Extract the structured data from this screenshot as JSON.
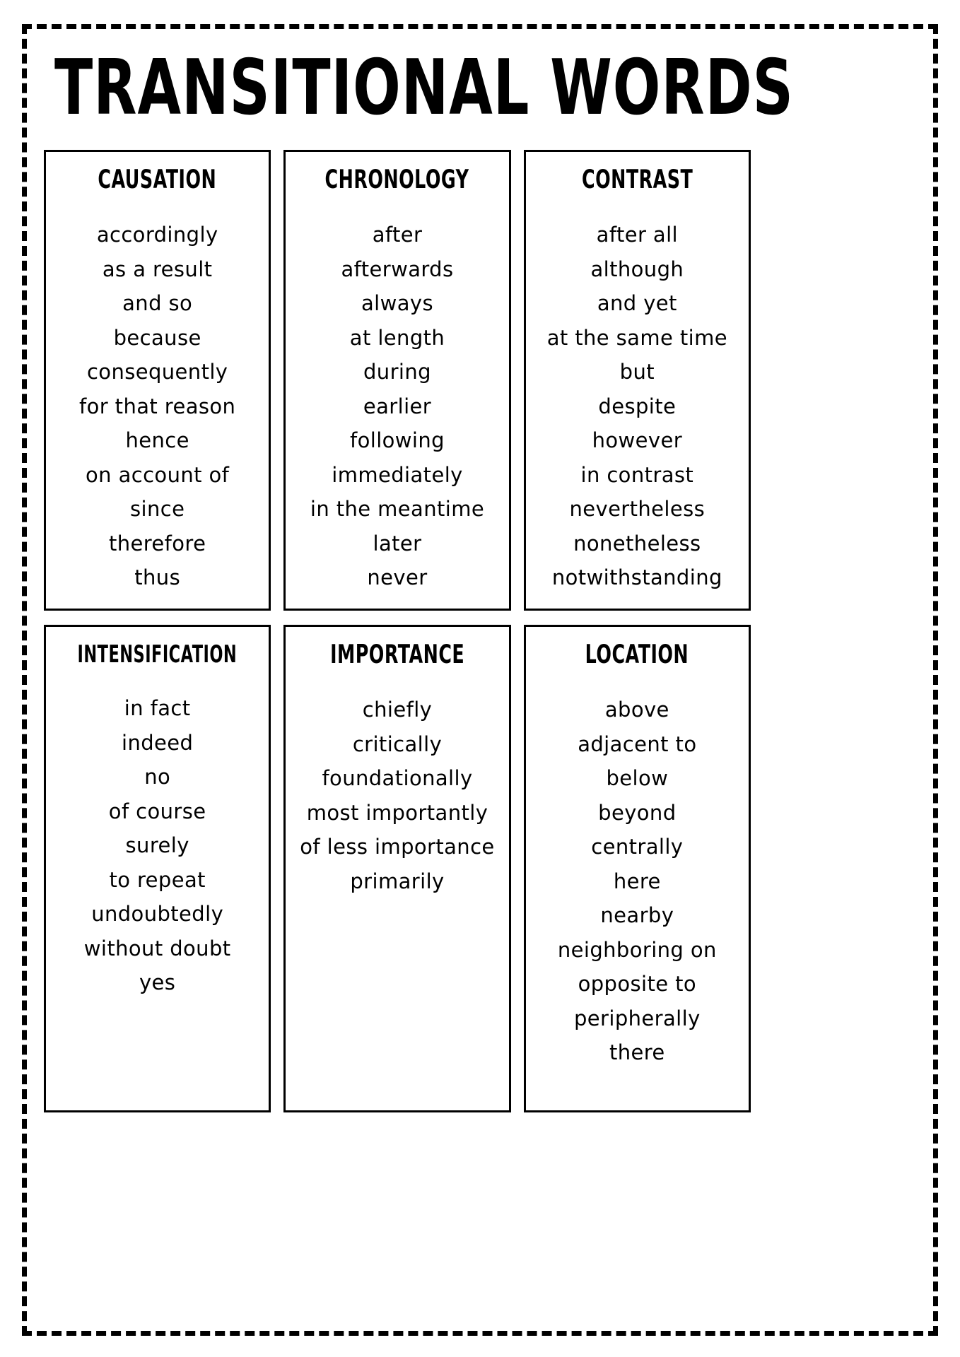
{
  "title": "TRANSITIONAL WORDS",
  "categories": [
    {
      "id": "causation",
      "heading": "CAUSATION",
      "words": [
        "accordingly",
        "as a result",
        "and so",
        "because",
        "consequently",
        "for that reason",
        "hence",
        "on account of",
        "since",
        "therefore",
        "thus"
      ]
    },
    {
      "id": "chronology",
      "heading": "CHRONOLOGY",
      "words": [
        "after",
        "afterwards",
        "always",
        "at length",
        "during",
        "earlier",
        "following",
        "immediately",
        "in the meantime",
        "later",
        "never"
      ]
    },
    {
      "id": "contrast",
      "heading": "CONTRAST",
      "words": [
        "after all",
        "although",
        "and yet",
        "at the same time",
        "but",
        "despite",
        "however",
        "in contrast",
        "nevertheless",
        "nonetheless",
        "notwithstanding"
      ]
    },
    {
      "id": "intensification",
      "heading": "INTENSIFICATION",
      "words": [
        "in fact",
        "indeed",
        "no",
        "of course",
        "surely",
        "to repeat",
        "undoubtedly",
        "without doubt",
        "yes"
      ]
    },
    {
      "id": "importance",
      "heading": "IMPORTANCE",
      "words": [
        "chiefly",
        "critically",
        "foundationally",
        "most importantly",
        "of less importance",
        "primarily"
      ]
    },
    {
      "id": "location",
      "heading": "LOCATION",
      "words": [
        "above",
        "adjacent to",
        "below",
        "beyond",
        "centrally",
        "here",
        "nearby",
        "neighboring on",
        "opposite to",
        "peripherally",
        "there"
      ]
    }
  ]
}
